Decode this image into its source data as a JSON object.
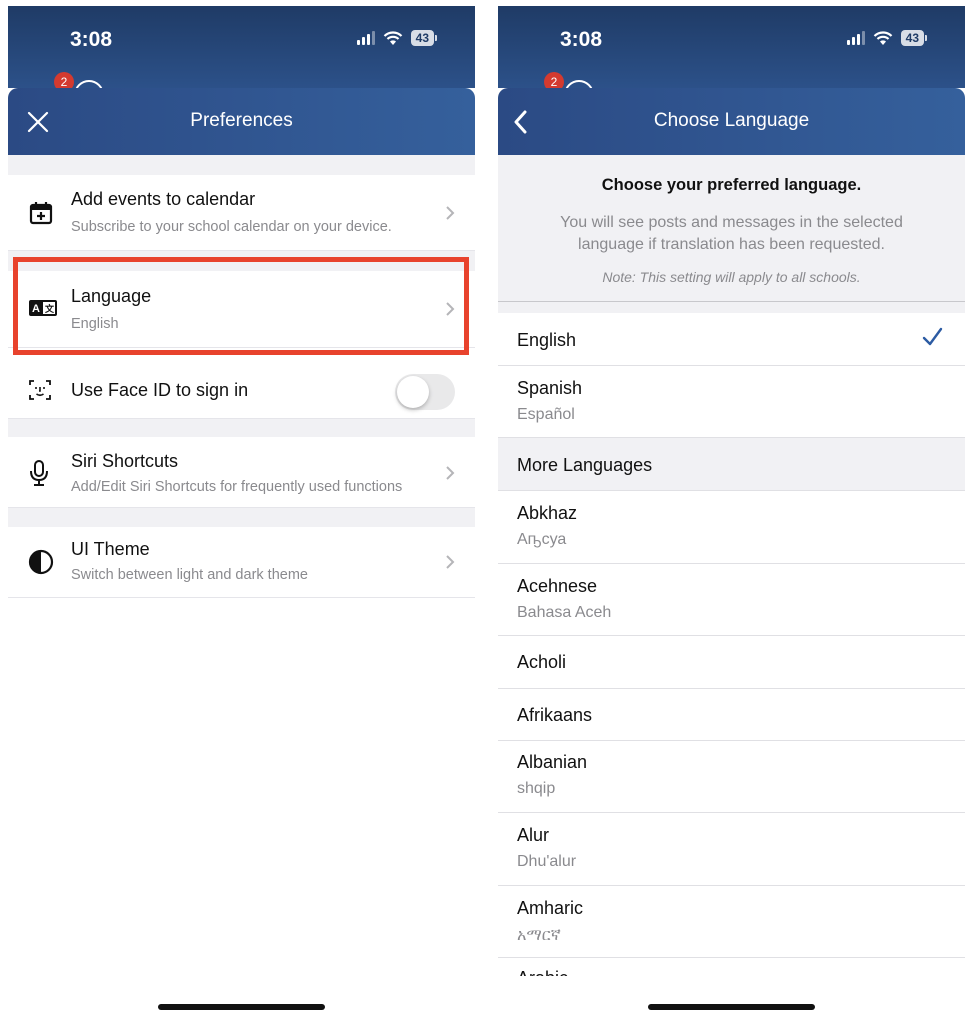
{
  "status": {
    "time": "3:08",
    "battery": "43"
  },
  "behind": {
    "badge_count": "2"
  },
  "left": {
    "title": "Preferences",
    "rows": {
      "calendar": {
        "title": "Add events to calendar",
        "subtitle": "Subscribe to your school calendar on your device."
      },
      "language": {
        "title": "Language",
        "subtitle": "English"
      },
      "faceid": {
        "title": "Use Face ID to sign in",
        "enabled": false
      },
      "siri": {
        "title": "Siri Shortcuts",
        "subtitle": "Add/Edit Siri Shortcuts for frequently used functions"
      },
      "theme": {
        "title": "UI Theme",
        "subtitle": "Switch between light and dark theme"
      }
    },
    "highlight_color": "#e8432d"
  },
  "right": {
    "title": "Choose Language",
    "intro": {
      "heading": "Choose your preferred language.",
      "body": "You will see posts and messages in the selected language if translation has been requested.",
      "note": "Note: This setting will apply to all schools."
    },
    "primary": [
      {
        "name": "English",
        "native": "",
        "selected": true
      },
      {
        "name": "Spanish",
        "native": "Español",
        "selected": false
      }
    ],
    "more_header": "More Languages",
    "more": [
      {
        "name": "Abkhaz",
        "native": "Аҧсуа"
      },
      {
        "name": "Acehnese",
        "native": "Bahasa Aceh"
      },
      {
        "name": "Acholi",
        "native": ""
      },
      {
        "name": "Afrikaans",
        "native": ""
      },
      {
        "name": "Albanian",
        "native": "shqip"
      },
      {
        "name": "Alur",
        "native": "Dhu'alur"
      },
      {
        "name": "Amharic",
        "native": "አማርኛ"
      },
      {
        "name": "Arabic",
        "native": ""
      }
    ]
  },
  "colors": {
    "header": "#2b4a84",
    "accent": "#2c5ba3",
    "badge": "#d43a2f"
  }
}
